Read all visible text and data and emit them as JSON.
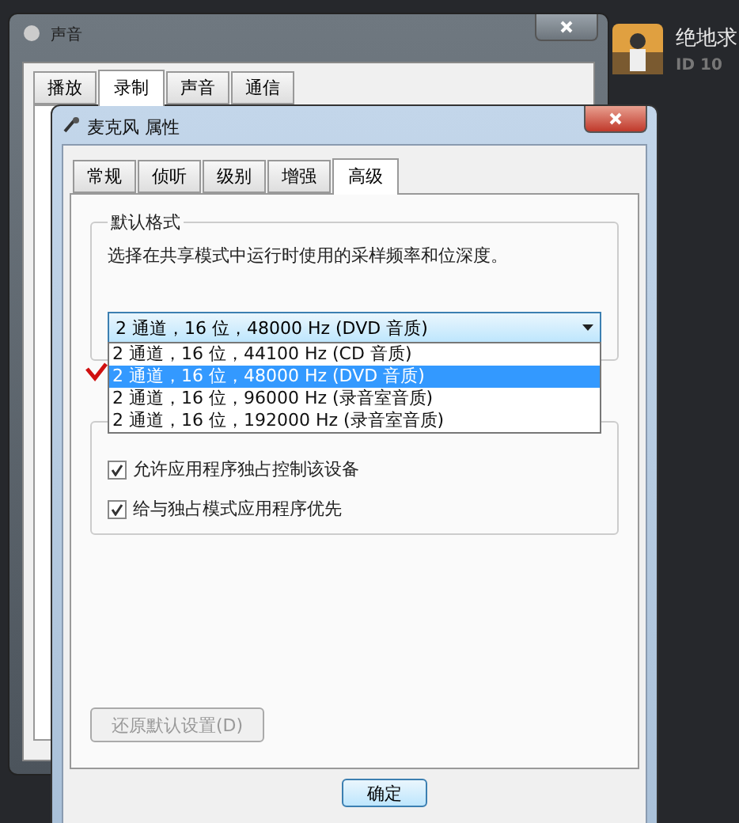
{
  "background_window": {
    "title": "声音",
    "tabs": [
      {
        "label": "播放",
        "selected": false
      },
      {
        "label": "录制",
        "selected": true
      },
      {
        "label": "声音",
        "selected": false
      },
      {
        "label": "通信",
        "selected": false
      }
    ]
  },
  "side_panel": {
    "title": "绝地求",
    "subtitle": "ID 10",
    "kind": "picture"
  },
  "dialog": {
    "title": "麦克风 属性",
    "tabs": [
      {
        "label": "常规",
        "selected": false
      },
      {
        "label": "侦听",
        "selected": false
      },
      {
        "label": "级别",
        "selected": false
      },
      {
        "label": "增强",
        "selected": false
      },
      {
        "label": "高级",
        "selected": true
      }
    ],
    "default_format": {
      "heading": "默认格式",
      "description": "选择在共享模式中运行时使用的采样频率和位深度。",
      "value": "2 通道，16 位，48000 Hz (DVD 音质)",
      "expanded": true,
      "options": [
        {
          "label": "2 通道，16 位，44100 Hz (CD 音质)",
          "selected": false
        },
        {
          "label": "2 通道，16 位，48000 Hz (DVD 音质)",
          "selected": true
        },
        {
          "label": "2 通道，16 位，96000 Hz (录音室音质)",
          "selected": false
        },
        {
          "label": "2 通道，16 位，192000 Hz (录音室音质)",
          "selected": false
        }
      ]
    },
    "exclusive_mode": {
      "options": [
        {
          "label": "允许应用程序独占控制该设备",
          "checked": true
        },
        {
          "label": "给与独占模式应用程序优先",
          "checked": true
        }
      ]
    },
    "restore_button": {
      "label": "还原默认设置(D)",
      "disabled": true
    },
    "buttons": [
      "确定"
    ]
  }
}
